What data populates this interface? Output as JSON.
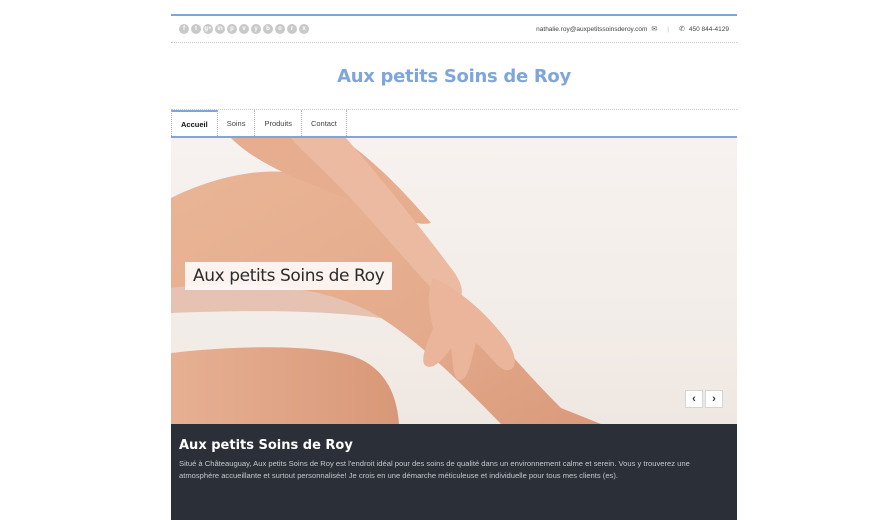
{
  "topbar": {
    "social_icons": [
      "f",
      "t",
      "g+",
      "in",
      "p",
      "v",
      "y",
      "b",
      "o",
      "r",
      "x"
    ],
    "email": "nathalie.roy@auxpetitssoinsderoy.com",
    "email_icon": "envelope-icon",
    "separator": "|",
    "phone_icon": "phone-icon",
    "phone": "450 844-4129"
  },
  "brand": {
    "title": "Aux petits Soins de Roy"
  },
  "nav": [
    {
      "label": "Accueil",
      "active": true
    },
    {
      "label": "Soins"
    },
    {
      "label": "Produits"
    },
    {
      "label": "Contact"
    }
  ],
  "hero": {
    "caption": "Aux petits Soins de Roy",
    "prev": "‹",
    "next": "›"
  },
  "intro": {
    "title": "Aux petits Soins de Roy",
    "text": "Situé à Châteauguay, Aux petits Soins de Roy est l'endroit idéal pour des soins de qualité dans un environnement calme et serein. Vous y trouverez une atmosphère accueillante et surtout personnalisée! Je crois en une démarche méticuleuse et individuelle pour tous mes clients (es)."
  },
  "colors": {
    "accent": "#7fa6dc",
    "band": "#2b3038"
  }
}
